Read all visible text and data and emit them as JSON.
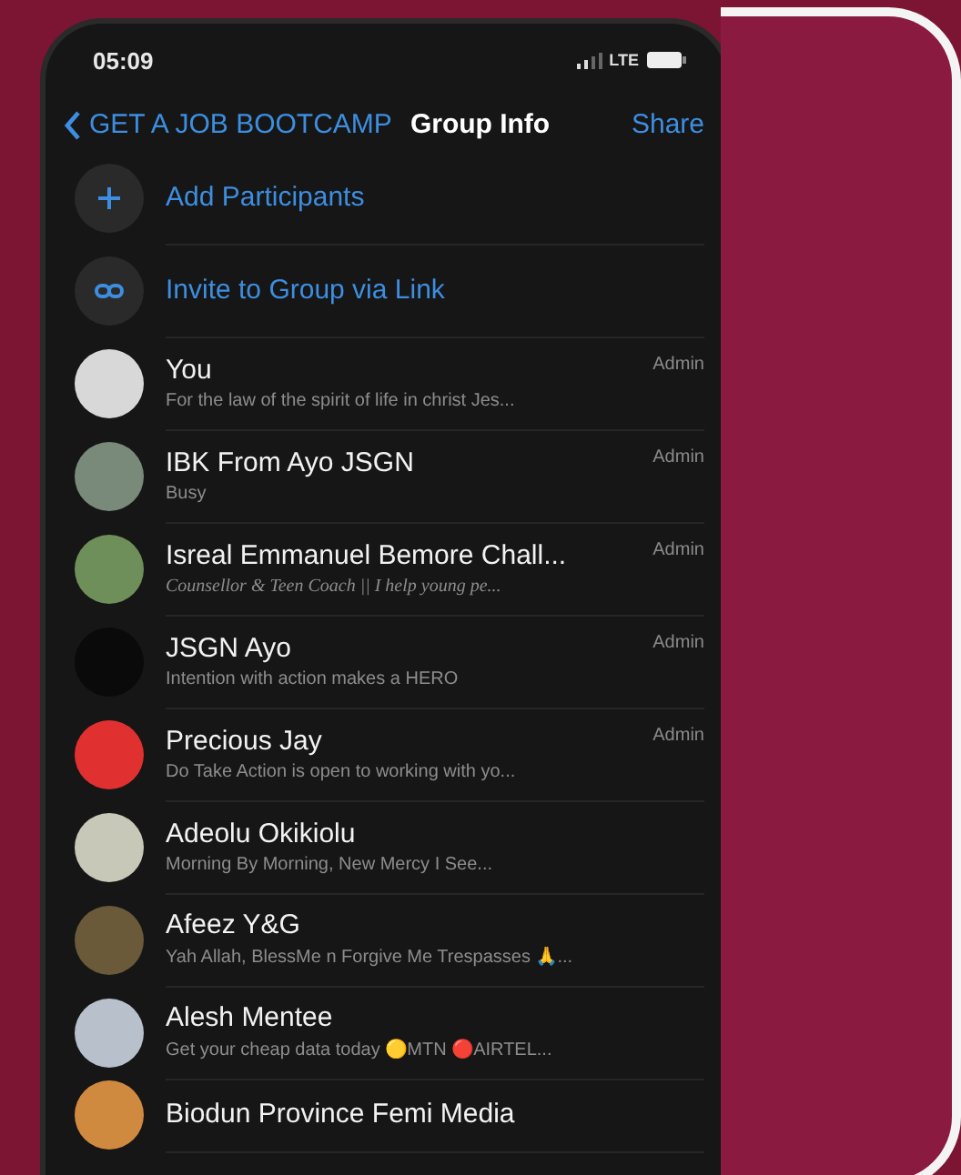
{
  "status_bar": {
    "time": "05:09",
    "network": "LTE"
  },
  "nav": {
    "back": "GET A JOB BOOTCAMP",
    "title": "Group Info",
    "action": "Share"
  },
  "actions": [
    {
      "kind": "add",
      "label": "Add Participants"
    },
    {
      "kind": "link",
      "label": "Invite to Group via Link"
    }
  ],
  "members": [
    {
      "name": "You",
      "subtitle": "For the law of the spirit of life in christ Jes...",
      "role": "Admin",
      "italic": false
    },
    {
      "name": "IBK From Ayo JSGN",
      "subtitle": "Busy",
      "role": "Admin",
      "italic": false
    },
    {
      "name": "Isreal Emmanuel Bemore Chall...",
      "subtitle": "Counsellor & Teen Coach || I help young pe...",
      "role": "Admin",
      "italic": true
    },
    {
      "name": "JSGN Ayo",
      "subtitle": "Intention with action makes a HERO",
      "role": "Admin",
      "italic": false
    },
    {
      "name": "Precious Jay",
      "subtitle": "Do Take Action is open to working with yo...",
      "role": "Admin",
      "italic": false
    },
    {
      "name": "Adeolu Okikiolu",
      "subtitle": "Morning By Morning, New Mercy I See...",
      "italic": false
    },
    {
      "name": "Afeez Y&G",
      "subtitle": "Yah Allah, BlessMe n Forgive Me Trespasses 🙏...",
      "italic": false
    },
    {
      "name": "Alesh Mentee",
      "subtitle": "Get your cheap data today 🟡MTN 🔴AIRTEL...",
      "italic": false
    },
    {
      "name": "Biodun Province Femi Media"
    }
  ]
}
